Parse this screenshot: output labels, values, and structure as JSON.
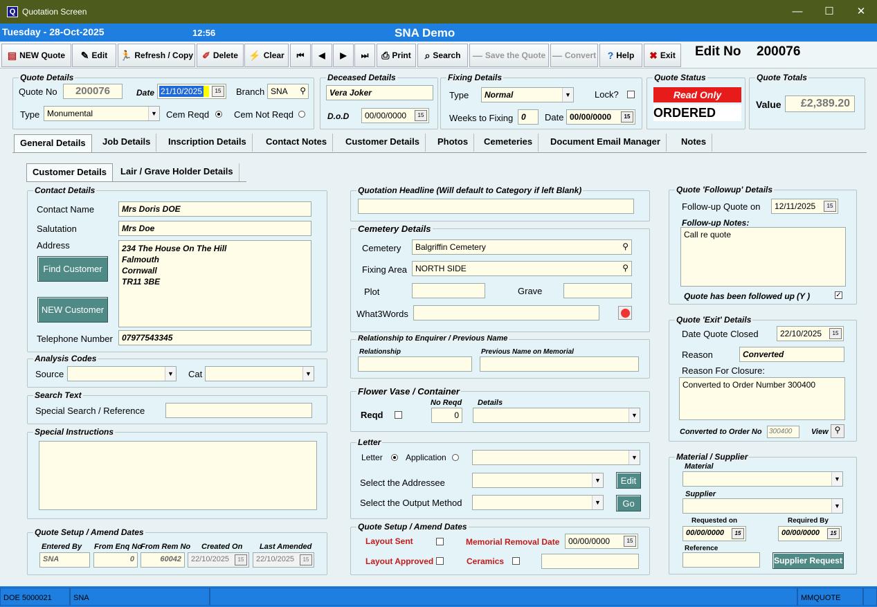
{
  "window": {
    "title": "Quotation Screen",
    "app_icon": "Q"
  },
  "header": {
    "date": "Tuesday - 28-Oct-2025",
    "time": "12:56",
    "company": "SNA Demo"
  },
  "toolbar": {
    "new_quote": "NEW Quote",
    "edit": "Edit",
    "refresh": "Refresh / Copy",
    "delete": "Delete",
    "clear": "Clear",
    "first": "⏮",
    "prev": "◀",
    "next": "▶",
    "last": "⏭",
    "print": "Print",
    "search": "Search",
    "save": "Save the Quote",
    "convert": "Convert",
    "help": "Help",
    "exit": "Exit"
  },
  "edit_no": {
    "label": "Edit No",
    "value": "200076"
  },
  "quote_details": {
    "title": "Quote Details",
    "quote_no_label": "Quote No",
    "quote_no": "200076",
    "date_label": "Date",
    "date": "21/10/2025",
    "branch_label": "Branch",
    "branch": "SNA",
    "type_label": "Type",
    "type": "Monumental",
    "cem_reqd": "Cem Reqd",
    "cem_not_reqd": "Cem Not Reqd"
  },
  "deceased": {
    "title": "Deceased Details",
    "name": "Vera Joker",
    "dod_label": "D.o.D",
    "dod": "00/00/0000"
  },
  "fixing": {
    "title": "Fixing Details",
    "type_label": "Type",
    "type": "Normal",
    "lock_label": "Lock?",
    "weeks_label": "Weeks to Fixing",
    "weeks": "0",
    "date_label": "Date",
    "date": "00/00/0000"
  },
  "quote_status": {
    "title": "Quote Status",
    "badge": "Read Only",
    "status": "ORDERED"
  },
  "quote_totals": {
    "title": "Quote Totals",
    "value_label": "Value",
    "value": "£2,389.20"
  },
  "main_tabs": [
    "General Details",
    "Job Details",
    "Inscription Details",
    "Contact Notes",
    "Customer Details",
    "Photos",
    "Cemeteries",
    "Document Email Manager",
    "Notes"
  ],
  "sub_tabs": [
    "Customer Details",
    "Lair / Grave Holder Details"
  ],
  "contact": {
    "title": "Contact Details",
    "name_label": "Contact Name",
    "name": "Mrs Doris DOE",
    "salutation_label": "Salutation",
    "salutation": "Mrs Doe",
    "address_label": "Address",
    "address1": "234 The House On The Hill",
    "address2": "Falmouth",
    "address3": "Cornwall",
    "address4": "TR11 3BE",
    "find_customer": "Find Customer",
    "new_customer": "NEW Customer",
    "phone_label": "Telephone Number",
    "phone": "07977543345"
  },
  "analysis": {
    "title": "Analysis Codes",
    "source_label": "Source",
    "cat_label": "Cat"
  },
  "search_text": {
    "title": "Search Text",
    "label": "Special Search / Reference"
  },
  "special_instructions": {
    "title": "Special Instructions"
  },
  "setup_left": {
    "title": "Quote Setup / Amend Dates",
    "entered_by_label": "Entered By",
    "entered_by": "SNA",
    "from_enq_label": "From Enq No",
    "from_enq": "0",
    "from_rem_label": "From Rem No",
    "from_rem": "60042",
    "created_label": "Created On",
    "created": "22/10/2025",
    "amended_label": "Last Amended",
    "amended": "22/10/2025"
  },
  "headline": {
    "title": "Quotation Headline (Will default to Category if left Blank)"
  },
  "cemetery": {
    "title": "Cemetery Details",
    "cemetery_label": "Cemetery",
    "cemetery": "Balgriffin Cemetery",
    "area_label": "Fixing Area",
    "area": "NORTH SIDE",
    "plot_label": "Plot",
    "grave_label": "Grave",
    "w3w_label": "What3Words"
  },
  "relationship": {
    "title": "Relationship to Enquirer / Previous Name",
    "rel_label": "Relationship",
    "prev_label": "Previous Name on Memorial"
  },
  "vase": {
    "title": "Flower Vase / Container",
    "reqd_label": "Reqd",
    "no_reqd_label": "No Reqd",
    "no_reqd": "0",
    "details_label": "Details"
  },
  "letter": {
    "title": "Letter",
    "letter_label": "Letter",
    "application_label": "Application",
    "addressee_label": "Select the Addressee",
    "edit": "Edit",
    "output_label": "Select the Output Method",
    "go": "Go"
  },
  "setup_mid": {
    "title": "Quote Setup / Amend Dates",
    "layout_sent": "Layout Sent",
    "layout_approved": "Layout Approved",
    "removal_label": "Memorial Removal Date",
    "removal": "00/00/0000",
    "ceramics": "Ceramics"
  },
  "followup": {
    "title": "Quote 'Followup' Details",
    "on_label": "Follow-up Quote on",
    "on": "12/11/2025",
    "notes_label": "Follow-up Notes:",
    "notes": "Call re quote",
    "followed_label": "Quote has been followed up",
    "yn": "(Y )"
  },
  "exit_details": {
    "title": "Quote 'Exit' Details",
    "closed_label": "Date Quote Closed",
    "closed": "22/10/2025",
    "reason_label": "Reason",
    "reason": "Converted",
    "closure_label": "Reason For Closure:",
    "closure": "Converted to Order Number  300400",
    "order_label": "Converted to Order No",
    "order": "300400",
    "view": "View"
  },
  "material": {
    "title": "Material / Supplier",
    "material_label": "Material",
    "supplier_label": "Supplier",
    "requested_label": "Requested on",
    "requested": "00/00/0000",
    "required_label": "Required By",
    "required": "00/00/0000",
    "reference_label": "Reference",
    "supplier_request": "Supplier Request"
  },
  "status": {
    "left": "DOE  5000021",
    "branch": "SNA",
    "right": "MMQUOTE"
  }
}
